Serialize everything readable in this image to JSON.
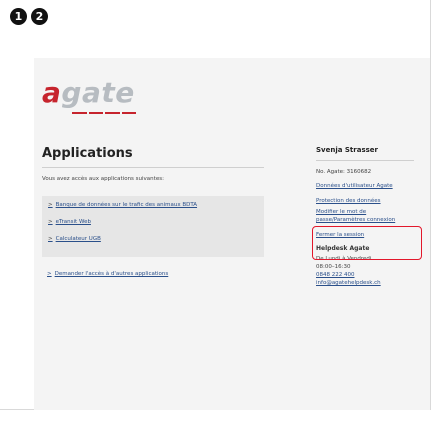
{
  "badges": [
    "1",
    "2"
  ],
  "logo": {
    "first": "a",
    "rest": "gate"
  },
  "main": {
    "title": "Applications",
    "intro": "Vous avez accès aux applications suivantes:",
    "apps": [
      "Banque de données sur le trafic des animaux BDTA",
      "eTransit Web",
      "Calculateur UGB"
    ],
    "request_link": "Demander l'accès à d'autres applications"
  },
  "sidebar": {
    "user": "Svenja Strasser",
    "agate_no": "No. Agate: 3160682",
    "links": [
      "Données d'utilisateur Agate",
      "Protection des données",
      "Modifier le mot de passe/Paramètres connexion",
      "Fermer la session"
    ],
    "helpdesk_title": "Helpdesk Agate",
    "hours_days": "De Lundi à Vendredi",
    "hours_time": "08:00–16:30",
    "phone": "0848 222 400",
    "email": "info@agatehelpdesk.ch"
  },
  "colors": {
    "brand_red": "#c6242d",
    "link": "#2a4f8a",
    "highlight": "#e2172b"
  }
}
